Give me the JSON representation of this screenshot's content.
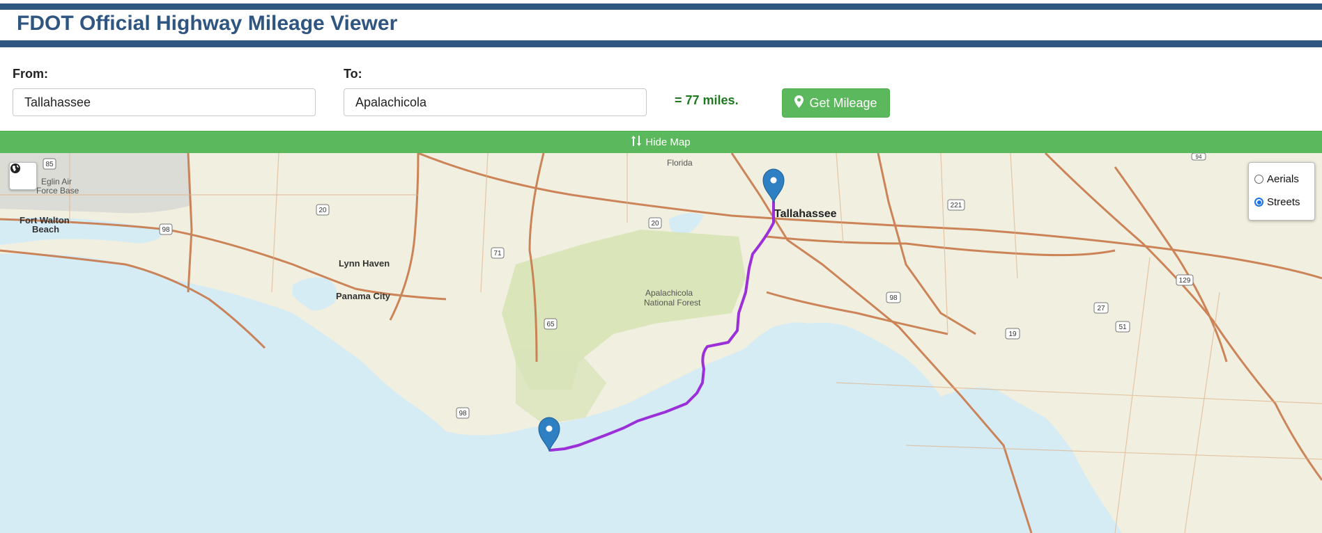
{
  "header": {
    "title": "FDOT Official Highway Mileage Viewer"
  },
  "form": {
    "from_label": "From:",
    "from_value": "Tallahassee",
    "to_label": "To:",
    "to_value": "Apalachicola",
    "result": "= 77 miles.",
    "get_mileage_label": "Get Mileage",
    "get_mileage_icon": "map-marker-icon"
  },
  "map_toggle": {
    "label": "Hide Map",
    "icon": "sort-arrows-icon"
  },
  "map": {
    "basemap_button_icon": "globe-icon",
    "layers": [
      {
        "label": "Aerials",
        "selected": false
      },
      {
        "label": "Streets",
        "selected": true
      }
    ],
    "place_labels": {
      "florida": "Florida",
      "eglin_1": "Eglin Air",
      "eglin_2": "Force Base",
      "fort_walton_1": "Fort Walton",
      "fort_walton_2": "Beach",
      "lynn_haven": "Lynn Haven",
      "panama_city": "Panama City",
      "tallahassee": "Tallahassee",
      "apalachicola_nf_1": "Apalachicola",
      "apalachicola_nf_2": "National Forest"
    },
    "route_shields": {
      "s85": "85",
      "s20a": "20",
      "s98a": "98",
      "s71": "71",
      "s20b": "20",
      "s65": "65",
      "s98b": "98",
      "s221": "221",
      "s98c": "98",
      "s129": "129",
      "s27": "27",
      "s51": "51",
      "s19": "19",
      "s94": "94"
    },
    "markers": [
      "Tallahassee",
      "Apalachicola"
    ],
    "route_color": "#9b30d9"
  }
}
